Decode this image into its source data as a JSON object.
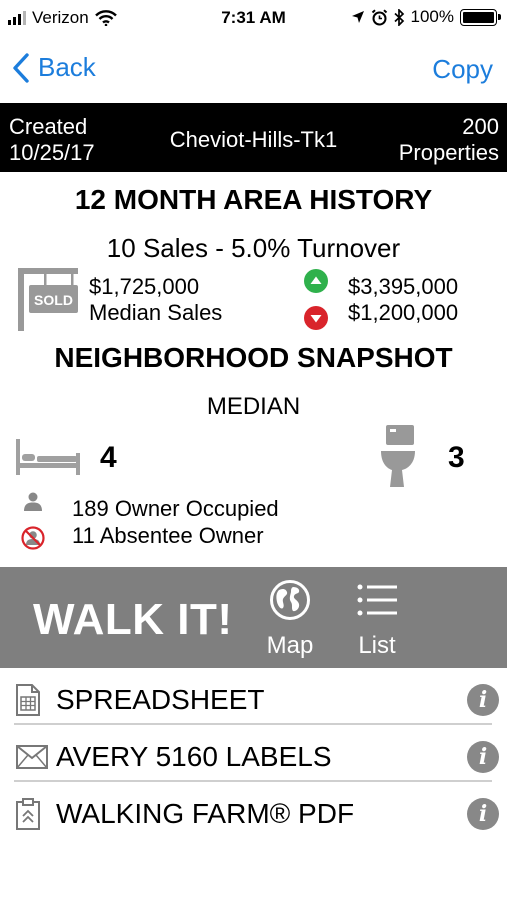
{
  "status_bar": {
    "carrier": "Verizon",
    "time": "7:31 AM",
    "battery": "100%"
  },
  "nav": {
    "back_label": "Back",
    "copy_label": "Copy"
  },
  "header": {
    "created_label": "Created",
    "created_date": "10/25/17",
    "farm_name": "Cheviot-Hills-Tk1",
    "properties_count": "200",
    "properties_label": "Properties"
  },
  "area_history": {
    "title": "12 MONTH AREA HISTORY",
    "summary": "10 Sales - 5.0% Turnover",
    "median_value": "$1,725,000",
    "median_label": "Median Sales",
    "high_value": "$3,395,000",
    "low_value": "$1,200,000",
    "sold_sign_text": "SOLD"
  },
  "snapshot": {
    "title": "NEIGHBORHOOD SNAPSHOT",
    "subtitle": "MEDIAN",
    "beds": "4",
    "baths": "3",
    "owner_occupied": "189 Owner Occupied",
    "absentee_owner": "11 Absentee Owner"
  },
  "walk": {
    "title": "WALK IT!",
    "map_label": "Map",
    "list_label": "List"
  },
  "exports": [
    {
      "label": "SPREADSHEET"
    },
    {
      "label": "AVERY 5160 LABELS"
    },
    {
      "label": "WALKING FARM® PDF"
    }
  ],
  "info_glyph": "i",
  "colors": {
    "link_blue": "#1c7ddc",
    "band_gray": "#7f7f7f",
    "up_green": "#2fb14c",
    "down_red": "#d9242b"
  }
}
